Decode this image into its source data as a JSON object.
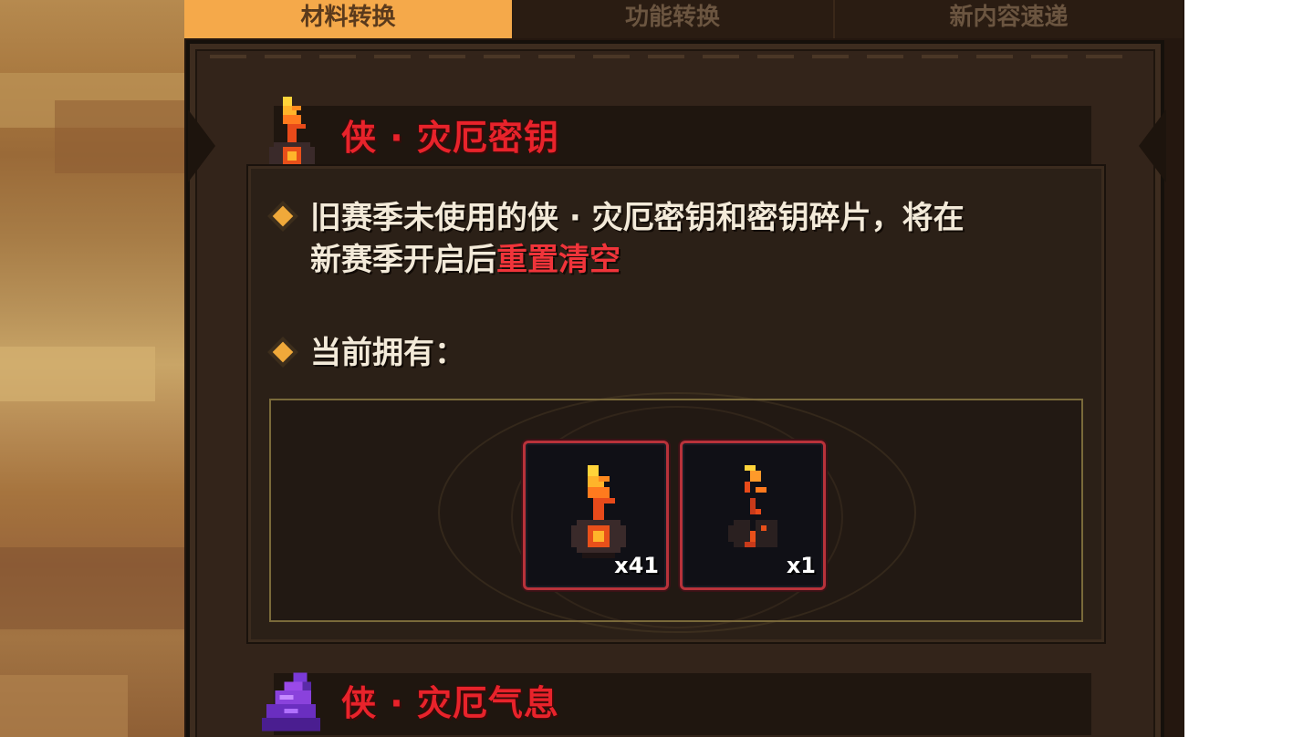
{
  "tabs": [
    {
      "label": "材料转换",
      "active": true
    },
    {
      "label": "功能转换",
      "active": false
    },
    {
      "label": "新内容速递",
      "active": false
    }
  ],
  "sections": [
    {
      "title": "侠 · 灾厄密钥",
      "icon": "fire-key-icon",
      "description_line1": "旧赛季未使用的侠 · 灾厄密钥和密钥碎片，将在",
      "description_line2_prefix": "新赛季开启后",
      "description_line2_highlight": "重置清空",
      "owned_label": "当前拥有：",
      "items": [
        {
          "name": "fire-key-icon",
          "count": "x41"
        },
        {
          "name": "key-fragment-icon",
          "count": "x1"
        }
      ]
    },
    {
      "title": "侠 · 灾厄气息",
      "icon": "purple-aura-icon"
    }
  ],
  "colors": {
    "accent_tab": "#f5a94a",
    "title_red": "#e8232b",
    "highlight_red": "#f0343a",
    "bullet_gold": "#f0a93a",
    "slot_border": "#b8323a"
  }
}
